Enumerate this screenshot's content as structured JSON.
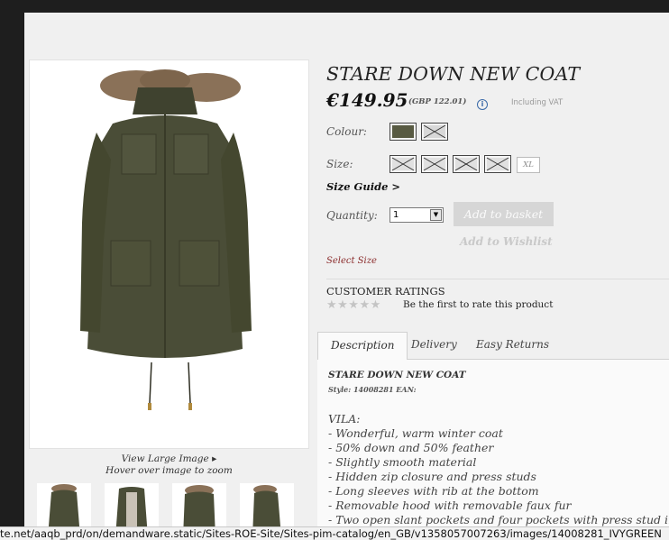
{
  "product": {
    "title": "STARE DOWN NEW COAT",
    "price": "€149.95",
    "price_gbp": "(GBP 122.01)",
    "info_icon_glyph": "i",
    "vat_note": "Including VAT"
  },
  "colour": {
    "label": "Colour:"
  },
  "size": {
    "label": "Size:",
    "xl_label": "XL",
    "guide_link": "Size Guide >"
  },
  "quantity": {
    "label": "Quantity:",
    "selected": "1",
    "arrow": "▼"
  },
  "actions": {
    "add_to_basket": "Add to basket",
    "add_to_wishlist": "Add to Wishlist",
    "select_size_notice": "Select Size"
  },
  "ratings": {
    "title": "CUSTOMER RATINGS",
    "stars": "★★★★★",
    "prompt": "Be the first to rate this product"
  },
  "tabs": [
    {
      "label": "Description"
    },
    {
      "label": "Delivery"
    },
    {
      "label": "Easy Returns"
    }
  ],
  "description": {
    "title": "STARE DOWN NEW COAT",
    "style_line": "Style: 14008281 EAN:",
    "lines": [
      "VILA:",
      "- Wonderful, warm winter coat",
      "- 50% down and 50% feather",
      "- Slightly smooth material",
      "- Hidden zip closure and press studs",
      "- Long sleeves with rib at the bottom",
      "- Removable hood with removable faux fur",
      "- Two open slant pockets and four pockets with press stud in"
    ]
  },
  "image_panel": {
    "view_large": "View Large Image ▸",
    "hover_zoom": "Hover over image to zoom"
  },
  "colors": {
    "coat": "#4a4d37",
    "fur": "#8a7158",
    "accent_disabled": "#d6d6d6"
  },
  "status_bar": {
    "url": "te.net/aaqb_prd/on/demandware.static/Sites-ROE-Site/Sites-pim-catalog/en_GB/v1358057007263/images/14008281_IVYGREEN"
  }
}
